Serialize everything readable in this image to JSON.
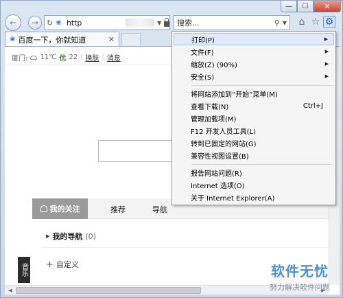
{
  "window": {
    "minimize_label": "—",
    "maximize_label": "☐",
    "close_label": "✕"
  },
  "toolbar": {
    "address_text": "http",
    "search_placeholder": "搜索..."
  },
  "tab": {
    "title": "百度一下，你就知道",
    "close_label": "✕"
  },
  "page": {
    "weather": {
      "city": "厦门:",
      "temp": "11℃",
      "aqi_label": "优",
      "aqi_value": "22",
      "link_change": "换肤",
      "link_message": "消息"
    },
    "feed_tabs": {
      "my_focus": "我的关注",
      "recommend": "推荐",
      "nav": "导航"
    },
    "my_nav": {
      "label": "我的导航",
      "count": "(0)"
    },
    "custom": "自定义",
    "music": "音乐"
  },
  "tools_menu": {
    "items": [
      {
        "label": "打印(P)",
        "has_submenu": true
      },
      {
        "label": "文件(F)",
        "has_submenu": true
      },
      {
        "label": "缩放(Z) (90%)",
        "has_submenu": true
      },
      {
        "label": "安全(S)",
        "has_submenu": true
      },
      {
        "label": "将网站添加到“开始”菜单(M)"
      },
      {
        "label": "查看下载(N)",
        "shortcut": "Ctrl+J"
      },
      {
        "label": "管理加载项(M)"
      },
      {
        "label": "F12 开发人员工具(L)"
      },
      {
        "label": "转到已固定的网站(G)"
      },
      {
        "label": "兼容性视图设置(B)"
      },
      {
        "label": "报告网站问题(R)"
      },
      {
        "label": "Internet 选项(O)"
      },
      {
        "label": "关于 Internet Explorer(A)"
      }
    ]
  },
  "watermark": {
    "title": "软件无忧",
    "subtitle": "努力解决软件问题"
  }
}
